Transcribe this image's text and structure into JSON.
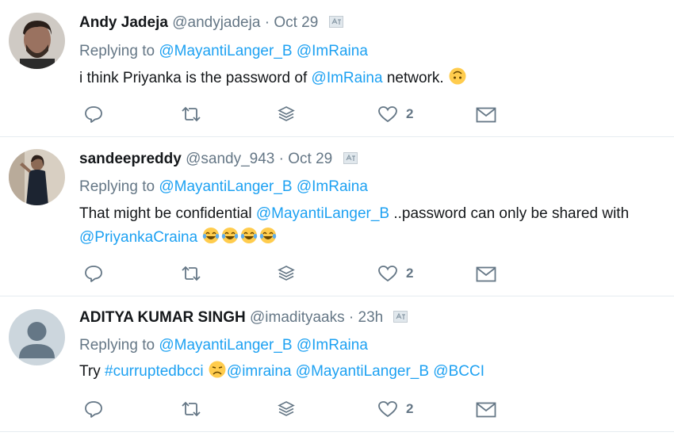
{
  "tweets": [
    {
      "name": "Andy Jadeja",
      "handle": "@andyjadeja",
      "dot": "·",
      "time": "Oct 29",
      "replying_prefix": "Replying to",
      "reply_to": [
        "@MayantiLanger_B",
        "@ImRaina"
      ],
      "text": {
        "a": "i think Priyanka is the password of ",
        "b": "@ImRaina",
        "c": " network. "
      },
      "like_count": "2"
    },
    {
      "name": "sandeepreddy",
      "handle": "@sandy_943",
      "dot": "·",
      "time": "Oct 29",
      "replying_prefix": "Replying to",
      "reply_to": [
        "@MayantiLanger_B",
        "@ImRaina"
      ],
      "text": {
        "a": "That might be confidential ",
        "b": "@MayantiLanger_B",
        "c": " ..password can only be shared with ",
        "d": "@PriyankaCraina"
      },
      "like_count": "2"
    },
    {
      "name": "ADITYA KUMAR SINGH",
      "handle": "@imadityaaks",
      "dot": "·",
      "time": "23h",
      "replying_prefix": "Replying to",
      "reply_to": [
        "@MayantiLanger_B",
        "@ImRaina"
      ],
      "text": {
        "a": "Try ",
        "b": "#curruptedbcci",
        "c": "@imraina",
        "d": "@MayantiLanger_B",
        "e": "@BCCI"
      },
      "like_count": "2"
    }
  ],
  "colors": {
    "link": "#1da1f2",
    "secondary": "#657786",
    "divider": "#e6ecf0",
    "icon": "#657786"
  },
  "icons": [
    "reply-icon",
    "retweet-icon",
    "stack-icon",
    "heart-icon",
    "mail-icon",
    "translate-icon"
  ]
}
